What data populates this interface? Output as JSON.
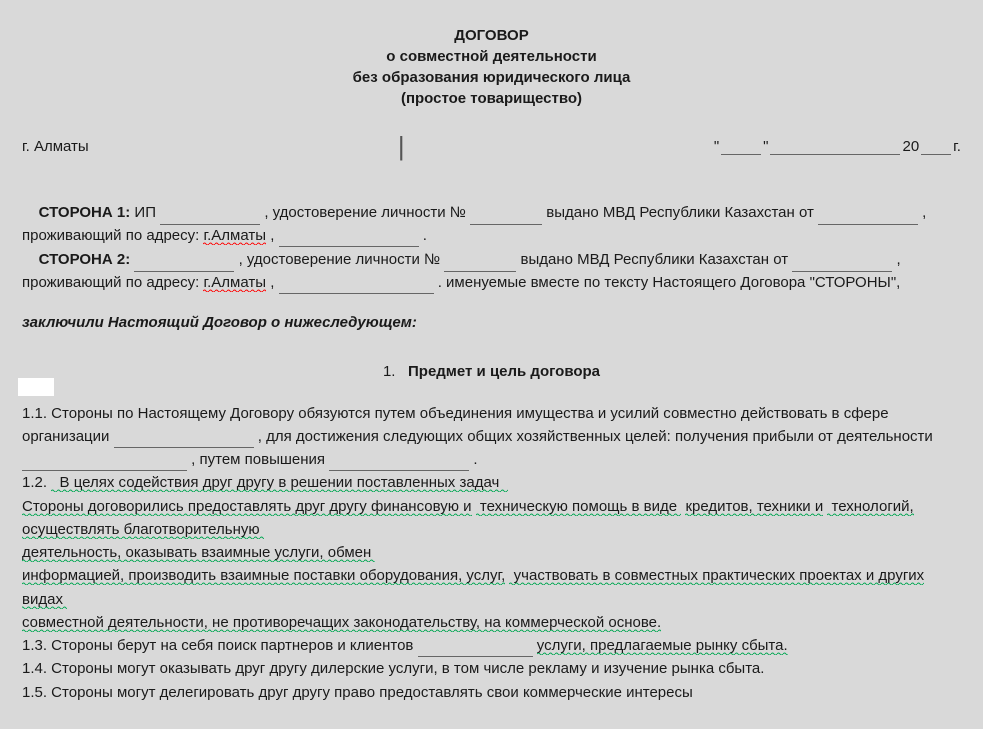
{
  "title": {
    "l1": "ДОГОВОР",
    "l2": "о совместной деятельности",
    "l3": "без образования юридического лица",
    "l4": "(простое товарищество)"
  },
  "city": "г. Алматы",
  "date": {
    "q1": "\"",
    "q2": "\"",
    "year_prefix": " 20",
    "year_suffix": "г."
  },
  "party1": {
    "label": "СТОРОНА 1:",
    "prefix": "ИП ",
    "id_text": ", удостоверение личности № ",
    "issued": "выдано МВД Республики Казахстан от ",
    "addr": ", проживающий по адресу: ",
    "city": "г.Алматы",
    "comma": ", ",
    "dot": "."
  },
  "party2": {
    "label": "СТОРОНА 2:",
    "id_text": ", удостоверение личности № ",
    "issued": "выдано МВД Республики Казахстан от ",
    "addr": ", проживающий по адресу: ",
    "city": "г.Алматы",
    "comma": ", ",
    "tail": ". именуемые вместе по тексту Настоящего Договора \"СТОРОНЫ\","
  },
  "concluded": "заключили Настоящий Договор о нижеследующем:",
  "section1": {
    "num": "1.",
    "title": "Предмет и цель договора"
  },
  "c11_a": "1.1. Стороны по Настоящему Договору обязуются путем объединения имущества и усилий совместно действовать в сфере организации ",
  "c11_b": ", для достижения следующих общих хозяйственных целей: получения прибыли от деятельности ",
  "c11_c": ", путем повышения ",
  "c11_d": ".",
  "c12_lead": "1.2.",
  "c12_p1": "В целях содействия друг другу в решении поставленных задач",
  "c12_p2a": "Стороны договорились предоставлять друг другу финансовую и",
  "c12_p2b": "техническую помощь в виде",
  "c12_p2c": "кредитов, техники и",
  "c12_p2d": "технологий, осуществлять благотворительную",
  "c12_p2e": "деятельность, оказывать взаимные услуги, обмен",
  "c12_p2f": "информацией, производить взаимные поставки оборудования, услуг,",
  "c12_p2g": "участвовать в совместных практических  проектах и других видах",
  "c12_p2h": "совместной деятельности, не противоречащих  законодательству, на коммерческой основе.",
  "c13_a": "1.3. Стороны берут на себя поиск партнеров и клиентов ",
  "c13_b": "услуги, предлагаемые рынку сбыта.",
  "c14": "1.4. Стороны могут оказывать друг другу дилерские услуги,  в том числе рекламу и  изучение рынка сбыта.",
  "c15": "1.5. Стороны могут делегировать друг другу право предоставлять свои коммерческие интересы"
}
